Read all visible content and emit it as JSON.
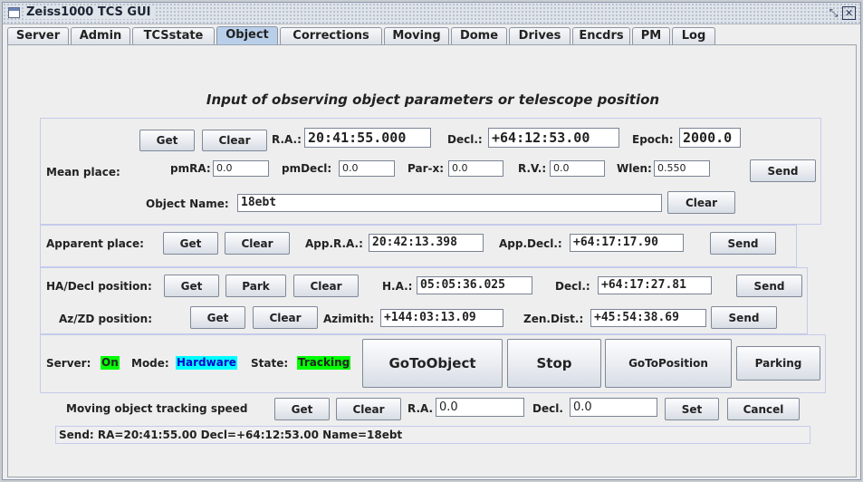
{
  "window": {
    "title": "Zeiss1000 TCS GUI",
    "restore_icon": "restore-icon",
    "close_icon": "close-icon"
  },
  "tabs": [
    "Server",
    "Admin",
    "TCSstate",
    "Object",
    "Corrections",
    "Moving",
    "Dome",
    "Drives",
    "Encdrs",
    "PM",
    "Log"
  ],
  "active_tab": "Object",
  "heading": "Input of observing object parameters or telescope position",
  "mean_place": {
    "label": "Mean place:",
    "get": "Get",
    "clear": "Clear",
    "send": "Send",
    "ra_label": "R.A.:",
    "ra": "20:41:55.000",
    "decl_label": "Decl.:",
    "decl": "+64:12:53.00",
    "epoch_label": "Epoch:",
    "epoch": "2000.0",
    "pmra_label": "pmRA:",
    "pmra": "0.0",
    "pmdecl_label": "pmDecl:",
    "pmdecl": "0.0",
    "parx_label": "Par-x:",
    "parx": "0.0",
    "rv_label": "R.V.:",
    "rv": "0.0",
    "wlen_label": "Wlen:",
    "wlen": "0.550",
    "name_label": "Object Name:",
    "name": "18ebt",
    "name_clear": "Clear"
  },
  "apparent_place": {
    "label": "Apparent place:",
    "get": "Get",
    "clear": "Clear",
    "send": "Send",
    "ra_label": "App.R.A.:",
    "ra": "20:42:13.398",
    "decl_label": "App.Decl.:",
    "decl": "+64:17:17.90"
  },
  "ha_decl": {
    "label": "HA/Decl position:",
    "get": "Get",
    "park": "Park",
    "clear": "Clear",
    "send": "Send",
    "ha_label": "H.A.:",
    "ha": "05:05:36.025",
    "decl_label": "Decl.:",
    "decl": "+64:17:27.81"
  },
  "az_zd": {
    "label": "Az/ZD position:",
    "get": "Get",
    "clear": "Clear",
    "send": "Send",
    "az_label": "Azimith:",
    "az": "+144:03:13.09",
    "zd_label": "Zen.Dist.:",
    "zd": "+45:54:38.69"
  },
  "state": {
    "server_label": "Server:",
    "server": "On",
    "mode_label": "Mode:",
    "mode": "Hardware",
    "state_label": "State:",
    "state": "Tracking",
    "goto_object": "GoToObject",
    "stop": "Stop",
    "goto_position": "GoToPosition",
    "parking": "Parking",
    "colors": {
      "on": "#00ff00",
      "hardware": "#00ffff",
      "tracking": "#00ff00",
      "hardware_text": "#0000cc"
    }
  },
  "moving": {
    "label": "Moving object tracking speed",
    "get": "Get",
    "clear": "Clear",
    "ra_label": "R.A.",
    "ra": "0.0",
    "decl_label": "Decl.",
    "decl": "0.0",
    "set": "Set",
    "cancel": "Cancel"
  },
  "status_line": "Send: RA=20:41:55.00 Decl=+64:12:53.00 Name=18ebt"
}
